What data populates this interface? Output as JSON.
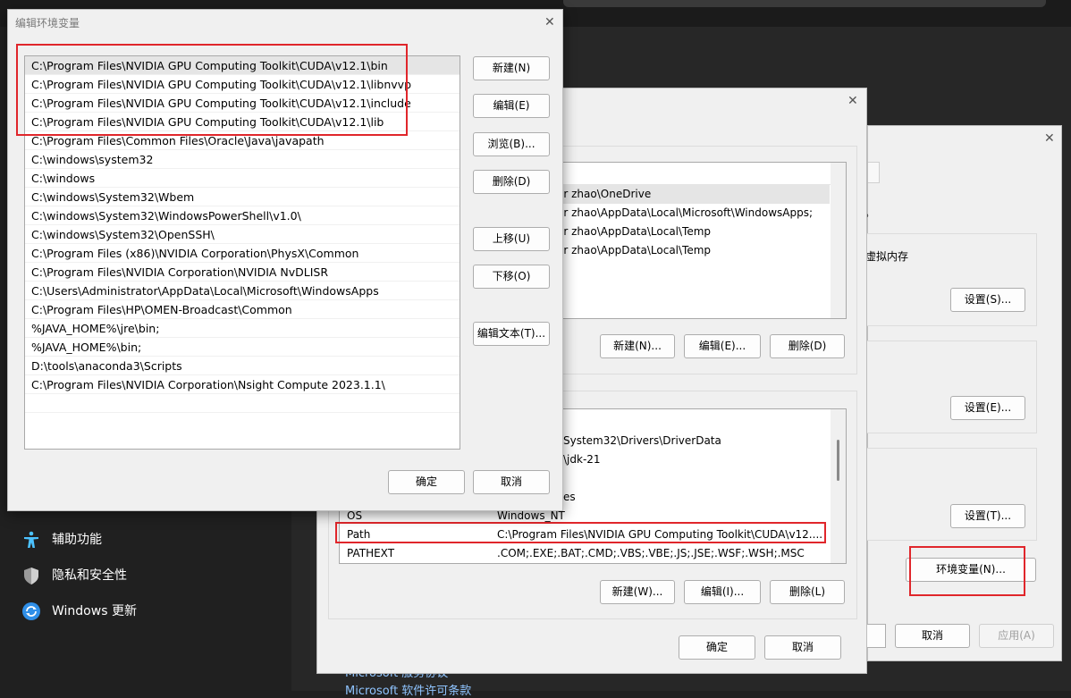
{
  "settings": {
    "nav": [
      {
        "label": "辅助功能",
        "icon": "accessibility-icon"
      },
      {
        "label": "隐私和安全性",
        "icon": "shield-icon"
      },
      {
        "label": "Windows 更新",
        "icon": "windows-update-icon"
      }
    ],
    "links": [
      "Microsoft 服务协议",
      "Microsoft 软件许可条款"
    ]
  },
  "system_properties": {
    "group_text": "虚拟内存",
    "settings_s": "设置(S)...",
    "settings_e": "设置(E)...",
    "settings_t": "设置(T)...",
    "env_button": "环境变量(N)...",
    "cancel": "取消",
    "apply": "应用(A)"
  },
  "env_vars": {
    "user_vars": [
      "er zhao\\OneDrive",
      "er zhao\\AppData\\Local\\Microsoft\\WindowsApps;",
      "er zhao\\AppData\\Local\\Temp",
      "er zhao\\AppData\\Local\\Temp"
    ],
    "user_new": "新建(N)...",
    "user_edit": "编辑(E)...",
    "user_delete": "删除(D)",
    "sys_vars": [
      {
        "name": "",
        "value": "System32\\Drivers\\DriverData"
      },
      {
        "name": "",
        "value": "\\jdk-21"
      },
      {
        "name": "",
        "value": ""
      },
      {
        "name": "",
        "value": "es"
      },
      {
        "name": "OS",
        "value": "Windows_NT"
      },
      {
        "name": "Path",
        "value": "C:\\Program Files\\NVIDIA GPU Computing Toolkit\\CUDA\\v12...."
      },
      {
        "name": "PATHEXT",
        "value": ".COM;.EXE;.BAT;.CMD;.VBS;.VBE;.JS;.JSE;.WSF;.WSH;.MSC"
      }
    ],
    "sys_new": "新建(W)...",
    "sys_edit": "编辑(I)...",
    "sys_delete": "删除(L)",
    "ok": "确定",
    "cancel": "取消"
  },
  "edit_env": {
    "title": "编辑环境变量",
    "paths": [
      "C:\\Program Files\\NVIDIA GPU Computing Toolkit\\CUDA\\v12.1\\bin",
      "C:\\Program Files\\NVIDIA GPU Computing Toolkit\\CUDA\\v12.1\\libnvvp",
      "C:\\Program Files\\NVIDIA GPU Computing Toolkit\\CUDA\\v12.1\\include",
      "C:\\Program Files\\NVIDIA GPU Computing Toolkit\\CUDA\\v12.1\\lib",
      "C:\\Program Files\\Common Files\\Oracle\\Java\\javapath",
      "C:\\windows\\system32",
      "C:\\windows",
      "C:\\windows\\System32\\Wbem",
      "C:\\windows\\System32\\WindowsPowerShell\\v1.0\\",
      "C:\\windows\\System32\\OpenSSH\\",
      "C:\\Program Files (x86)\\NVIDIA Corporation\\PhysX\\Common",
      "C:\\Program Files\\NVIDIA Corporation\\NVIDIA NvDLISR",
      "C:\\Users\\Administrator\\AppData\\Local\\Microsoft\\WindowsApps",
      "C:\\Program Files\\HP\\OMEN-Broadcast\\Common",
      "%JAVA_HOME%\\jre\\bin;",
      "%JAVA_HOME%\\bin;",
      "D:\\tools\\anaconda3\\Scripts",
      "C:\\Program Files\\NVIDIA Corporation\\Nsight Compute 2023.1.1\\"
    ],
    "buttons": {
      "new": "新建(N)",
      "edit": "编辑(E)",
      "browse": "浏览(B)...",
      "delete": "删除(D)",
      "move_up": "上移(U)",
      "move_down": "下移(O)",
      "edit_text": "编辑文本(T)..."
    },
    "ok": "确定",
    "cancel": "取消"
  }
}
